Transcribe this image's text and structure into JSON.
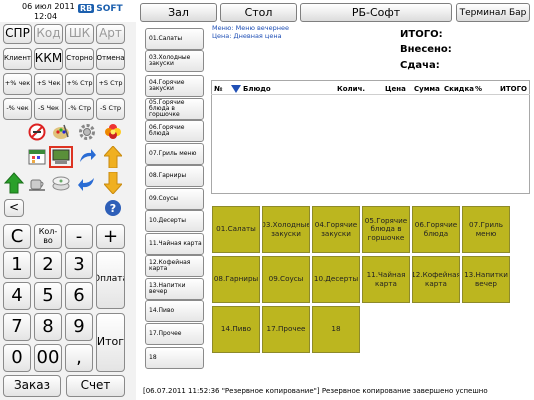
{
  "header": {
    "date": "06 июл 2011",
    "time": "12:04",
    "logo_rb": "RB",
    "logo_soft": "SOFT"
  },
  "top": {
    "hall": "Зал",
    "table": "Стол",
    "rbsoft": "РБ-Софт",
    "terminal": "Терминал Бар"
  },
  "menu_info": {
    "menu": "Меню: Меню вечернее",
    "price": "Цена: Дневная цена"
  },
  "totals": {
    "total": "ИТОГО:",
    "paid": "Внесено:",
    "change": "Сдача:"
  },
  "order_table": {
    "columns": [
      "№",
      "Блюдо",
      "Колич.",
      "Цена",
      "Сумма",
      "Скидка",
      "%",
      "ИТОГО"
    ]
  },
  "keypad": {
    "row1": [
      "СПР",
      "Код",
      "ШК",
      "Арт"
    ],
    "row2": [
      "Клиент",
      "ККМ",
      "Сторно",
      "Отмена"
    ],
    "row3": [
      "+% чек",
      "+S Чек",
      "+% Стр",
      "+S Стр"
    ],
    "row4": [
      "-% чек",
      "-S Чек",
      "-% Стр",
      "-S Стр"
    ],
    "back": "<",
    "clear": "C",
    "qty": "Кол-во",
    "minus": "-",
    "plus": "+",
    "digits": [
      "1",
      "2",
      "3",
      "4",
      "5",
      "6",
      "7",
      "8",
      "9",
      "0",
      "00",
      ","
    ],
    "pay": "Оплата",
    "total": "Итог",
    "order": "Заказ",
    "bill": "Счет"
  },
  "categories": [
    "01.Салаты",
    "03.Холодные закуски",
    "04.Горячие закуски",
    "05.Горячие блюда в горшочке",
    "06.Горячие блюда",
    "07.Гриль меню",
    "08.Гарниры",
    "09.Соусы",
    "10.Десерты",
    "11.Чайная карта",
    "12.Кофейная карта",
    "13.Напитки вечер",
    "14.Пиво",
    "17.Прочее",
    "18"
  ],
  "tiles": [
    "01.Салаты",
    "03.Холодные закуски",
    "04.Горячие закуски",
    "05.Горячие блюда в горшочке",
    "06.Горячие блюда",
    "07.Гриль меню",
    "08.Гарниры",
    "09.Соусы",
    "10.Десерты",
    "11.Чайная карта",
    "12.Кофейная карта",
    "13.Напитки вечер",
    "14.Пиво",
    "17.Прочее",
    "18"
  ],
  "status": "[06.07.2011 11:52:36 \"Резервное копирование\"] Резервное копирование завершено успешно",
  "colors": {
    "tile": "#bcb61f",
    "accent_blue": "#1f4fb5",
    "logo": "#1b5fae"
  },
  "icons": [
    "no-smoking-icon",
    "palette-icon",
    "gear-icon",
    "flower-icon",
    "calendar-icon",
    "terminal-icon",
    "arrow-right-icon",
    "arrow-up-icon",
    "arrow-green-up-icon",
    "cup-icon",
    "disk-icon",
    "arrow-back-icon",
    "arrow-down-icon",
    "help-icon"
  ]
}
